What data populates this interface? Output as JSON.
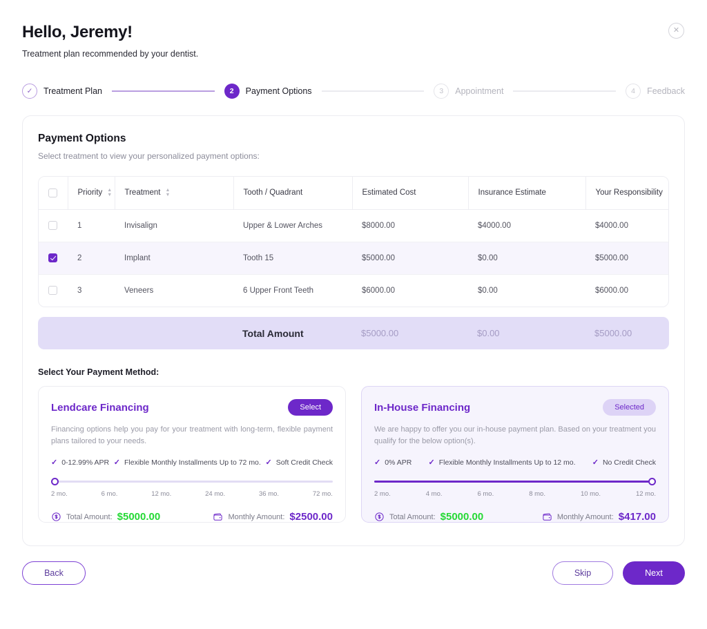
{
  "header": {
    "greeting": "Hello, Jeremy!",
    "subtitle": "Treatment plan recommended by your dentist.",
    "close_icon": "close-icon"
  },
  "stepper": {
    "steps": [
      {
        "marker": "✓",
        "label": "Treatment Plan",
        "state": "done"
      },
      {
        "marker": "2",
        "label": "Payment Options",
        "state": "active"
      },
      {
        "marker": "3",
        "label": "Appointment",
        "state": "todo"
      },
      {
        "marker": "4",
        "label": "Feedback",
        "state": "todo"
      }
    ]
  },
  "payment_options": {
    "title": "Payment Options",
    "subtitle": "Select treatment to view your personalized payment options:",
    "columns": [
      "Priority",
      "Treatment",
      "Tooth / Quadrant",
      "Estimated Cost",
      "Insurance Estimate",
      "Your Responsibility"
    ],
    "rows": [
      {
        "checked": false,
        "priority": "1",
        "treatment": "Invisalign",
        "tooth": "Upper & Lower Arches",
        "estimated_cost": "$8000.00",
        "insurance_estimate": "$4000.00",
        "your_responsibility": "$4000.00"
      },
      {
        "checked": true,
        "priority": "2",
        "treatment": "Implant",
        "tooth": "Tooth 15",
        "estimated_cost": "$5000.00",
        "insurance_estimate": "$0.00",
        "your_responsibility": "$5000.00"
      },
      {
        "checked": false,
        "priority": "3",
        "treatment": "Veneers",
        "tooth": "6 Upper Front Teeth",
        "estimated_cost": "$6000.00",
        "insurance_estimate": "$0.00",
        "your_responsibility": "$6000.00"
      }
    ],
    "totals": {
      "label": "Total Amount",
      "estimated_cost": "$5000.00",
      "insurance_estimate": "$0.00",
      "your_responsibility": "$5000.00"
    }
  },
  "payment_method": {
    "label": "Select Your Payment Method:",
    "cards": [
      {
        "title": "Lendcare Financing",
        "action_label": "Select",
        "state": "unselected",
        "description": "Financing options help you pay for your treatment with long-term, flexible payment plans tailored to your needs.",
        "features": [
          "0-12.99% APR",
          "Flexible Monthly Installments Up to 72 mo.",
          "Soft Credit Check"
        ],
        "slider": {
          "ticks": [
            "2 mo.",
            "6 mo.",
            "12 mo.",
            "24 mo.",
            "36 mo.",
            "72 mo."
          ],
          "value_percent": 0
        },
        "total_label": "Total Amount:",
        "total_value": "$5000.00",
        "monthly_label": "Monthly Amount:",
        "monthly_value": "$2500.00"
      },
      {
        "title": "In-House Financing",
        "action_label": "Selected",
        "state": "selected",
        "description": "We are happy to offer you our in-house payment plan. Based on your treatment you qualify for the below option(s).",
        "features": [
          "0% APR",
          "Flexible Monthly Installments Up to 12 mo.",
          "No Credit Check"
        ],
        "slider": {
          "ticks": [
            "2 mo.",
            "4 mo.",
            "6 mo.",
            "8 mo.",
            "10 mo.",
            "12 mo."
          ],
          "value_percent": 100
        },
        "total_label": "Total Amount:",
        "total_value": "$5000.00",
        "monthly_label": "Monthly Amount:",
        "monthly_value": "$417.00"
      }
    ]
  },
  "footer": {
    "back": "Back",
    "skip": "Skip",
    "next": "Next"
  },
  "colors": {
    "accent": "#6d28c9",
    "accent_soft": "#ddd3f6",
    "total_green": "#25d935",
    "row_selected": "#f7f5fd",
    "totals_band": "#e2ddf7"
  }
}
